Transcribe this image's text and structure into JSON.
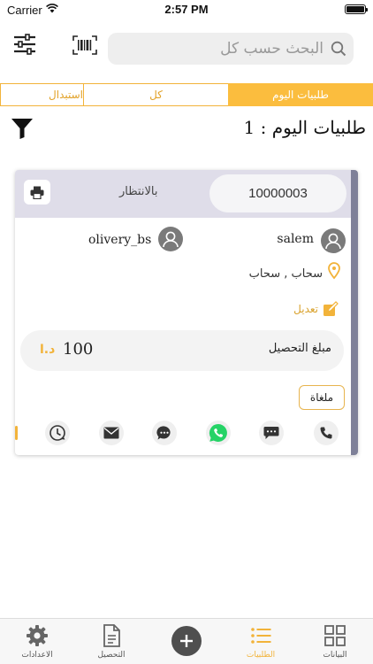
{
  "status_bar": {
    "carrier": "Carrier",
    "time": "2:57 PM"
  },
  "search": {
    "placeholder": "البحث حسب كل"
  },
  "tabs": [
    {
      "label": "طلبيات اليوم",
      "active": true
    },
    {
      "label": "كل",
      "active": false
    },
    {
      "label": "استبدال",
      "active": false
    }
  ],
  "page_title": "طلبيات اليوم : 1",
  "order": {
    "number": "10000003",
    "status": "بالانتظار",
    "customer_name": "salem",
    "driver_name": "olivery_bs",
    "address": "سحاب , سحاب",
    "edit_label": "تعديل",
    "amount_label": "مبلغ التحصيل",
    "amount_value": "100",
    "currency": "د.ا",
    "cancel_label": "ملغاة"
  },
  "tabbar": {
    "settings": "الاعدادات",
    "collection": "التحصيل",
    "orders": "الطلبيات",
    "data": "البيانات"
  },
  "colors": {
    "accent": "#fbbd3e",
    "card_header": "#dfdde9",
    "card_edge": "#7e8098",
    "whatsapp": "#25d366"
  },
  "icons": [
    "settings-sliders-icon",
    "barcode-icon",
    "search-icon",
    "funnel-icon",
    "printer-icon",
    "user-icon",
    "location-pin-icon",
    "edit-icon",
    "phone-icon",
    "sms-icon",
    "whatsapp-icon",
    "chat-icon",
    "email-icon",
    "tracking-icon",
    "gear-icon",
    "document-icon",
    "plus-icon",
    "list-icon",
    "grid-icon"
  ]
}
